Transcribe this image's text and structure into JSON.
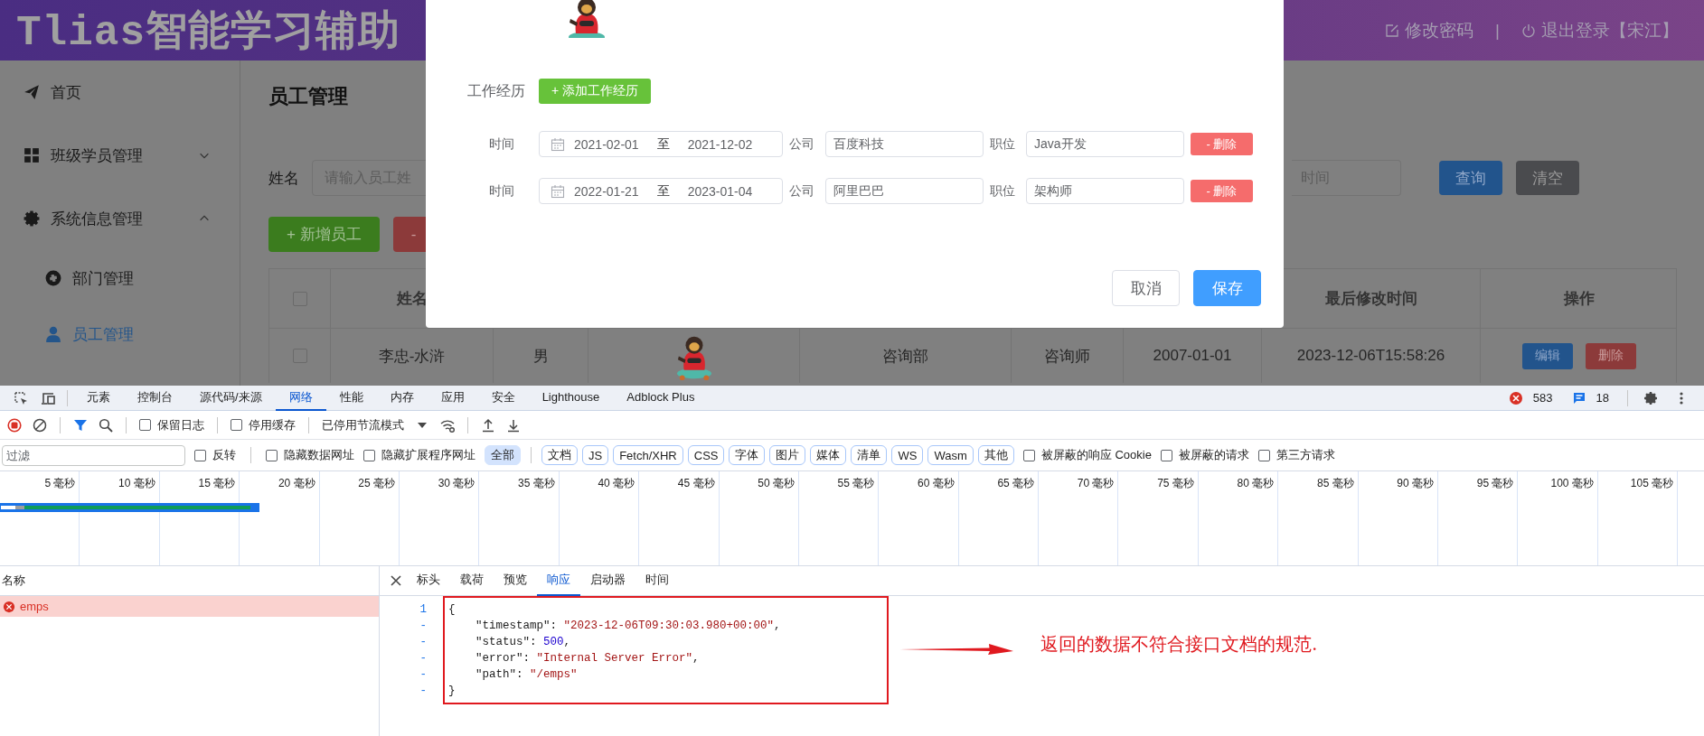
{
  "app": {
    "header": {
      "title": "Tlias智能学习辅助",
      "separator": "|",
      "links": [
        {
          "kind": "edit",
          "label": "修改密码"
        },
        {
          "kind": "power",
          "label": "退出登录【宋江】"
        }
      ]
    },
    "sidebar": {
      "items": [
        {
          "label": "首页",
          "selected": false
        },
        {
          "label": "班级学员管理",
          "selected": false,
          "expanded": false
        },
        {
          "label": "系统信息管理",
          "selected": false,
          "expanded": true,
          "children": [
            {
              "label": "部门管理",
              "selected": false
            },
            {
              "label": "员工管理",
              "selected": true
            }
          ]
        }
      ]
    },
    "page_title": "员工管理",
    "search": {
      "name_label": "姓名",
      "name_placeholder": "请输入员工姓",
      "end_placeholder": "时间",
      "buttons": [
        {
          "kind": "primary",
          "label": "查询"
        },
        {
          "kind": "info",
          "label": "清空"
        }
      ]
    },
    "actions": [
      {
        "kind": "success",
        "label": "+ 新增员工"
      },
      {
        "kind": "danger",
        "label": "-"
      }
    ],
    "table": {
      "header_checked": false,
      "header": {
        "name": "姓名",
        "last_modified": "最后修改时间",
        "operations": "操作"
      },
      "rows": [
        {
          "checked": false,
          "name": "李忠-水浒",
          "gender": "男",
          "avatar": {
            "kind": "picture"
          },
          "dept": "咨询部",
          "job": "咨询师",
          "entry_date": "2007-01-01",
          "last_modified": "2023-12-06T15:58:26",
          "buttons": [
            {
              "kind": "primary",
              "label": "编辑"
            },
            {
              "kind": "danger",
              "label": "删除"
            }
          ]
        }
      ]
    },
    "dialog": {
      "avatar": {
        "kind": "picture"
      },
      "section_label": "工作经历",
      "add_button": "+ 添加工作经历",
      "rows": [
        {
          "time_label": "时间",
          "start": "2021-02-01",
          "range_sep": "至",
          "end": "2021-12-02",
          "company_label": "公司",
          "company": "百度科技",
          "position_label": "职位",
          "position": "Java开发",
          "delete_button": "- 删除"
        },
        {
          "time_label": "时间",
          "start": "2022-01-21",
          "range_sep": "至",
          "end": "2023-01-04",
          "company_label": "公司",
          "company": "阿里巴巴",
          "position_label": "职位",
          "position": "架构师",
          "delete_button": "- 删除"
        }
      ],
      "buttons": [
        {
          "kind": "default",
          "label": "取消"
        },
        {
          "kind": "primary",
          "label": "保存"
        }
      ]
    }
  },
  "devtools": {
    "tabs": [
      {
        "label": "元素",
        "selected": false
      },
      {
        "label": "控制台",
        "selected": false
      },
      {
        "label": "源代码/来源",
        "selected": false
      },
      {
        "label": "网络",
        "selected": true
      },
      {
        "label": "性能",
        "selected": false
      },
      {
        "label": "内存",
        "selected": false
      },
      {
        "label": "应用",
        "selected": false
      },
      {
        "label": "安全",
        "selected": false
      },
      {
        "label": "Lighthouse",
        "selected": false
      },
      {
        "label": "Adblock Plus",
        "selected": false
      }
    ],
    "error_count": "583",
    "message_count": "18",
    "toolbar": {
      "checkboxes": [
        {
          "label": "保留日志",
          "checked": false
        },
        {
          "label": "停用缓存",
          "checked": false
        }
      ],
      "throttling": "已停用节流模式"
    },
    "filter": {
      "placeholder": "过滤",
      "invert": {
        "label": "反转",
        "checked": false
      },
      "options": [
        {
          "label": "隐藏数据网址",
          "checked": false
        },
        {
          "label": "隐藏扩展程序网址",
          "checked": false
        }
      ],
      "types": [
        {
          "label": "全部",
          "selected": true
        },
        {
          "label": "文档",
          "selected": false
        },
        {
          "label": "JS",
          "selected": false
        },
        {
          "label": "Fetch/XHR",
          "selected": false
        },
        {
          "label": "CSS",
          "selected": false
        },
        {
          "label": "字体",
          "selected": false
        },
        {
          "label": "图片",
          "selected": false
        },
        {
          "label": "媒体",
          "selected": false
        },
        {
          "label": "清单",
          "selected": false
        },
        {
          "label": "WS",
          "selected": false
        },
        {
          "label": "Wasm",
          "selected": false
        },
        {
          "label": "其他",
          "selected": false
        }
      ],
      "extra": [
        {
          "label": "被屏蔽的响应 Cookie",
          "checked": false
        },
        {
          "label": "被屏蔽的请求",
          "checked": false
        },
        {
          "label": "第三方请求",
          "checked": false
        }
      ]
    },
    "timeline": {
      "ticks": [
        "5 毫秒",
        "10 毫秒",
        "15 毫秒",
        "20 毫秒",
        "25 毫秒",
        "30 毫秒",
        "35 毫秒",
        "40 毫秒",
        "45 毫秒",
        "50 毫秒",
        "55 毫秒",
        "60 毫秒",
        "65 毫秒",
        "70 毫秒",
        "75 毫秒",
        "80 毫秒",
        "85 毫秒",
        "90 毫秒",
        "95 毫秒",
        "100 毫秒",
        "105 毫秒"
      ]
    },
    "requests": {
      "header": "名称",
      "rows": [
        {
          "name": "emps",
          "error": true
        }
      ]
    },
    "detail": {
      "tabs": [
        {
          "label": "标头",
          "selected": false
        },
        {
          "label": "载荷",
          "selected": false
        },
        {
          "label": "预览",
          "selected": false
        },
        {
          "label": "响应",
          "selected": true
        },
        {
          "label": "启动器",
          "selected": false
        },
        {
          "label": "时间",
          "selected": false
        }
      ],
      "line_numbers": [
        "1",
        "-",
        "-",
        "-",
        "-",
        "-"
      ],
      "lines": [
        {
          "kind": "brace",
          "parts": [
            {
              "kind": "punct",
              "text": "{"
            }
          ]
        },
        {
          "kind": "member",
          "parts": [
            {
              "kind": "key",
              "text": "\"timestamp\": "
            },
            {
              "kind": "string",
              "text": "\"2023-12-06T09:30:03.980+00:00\""
            },
            {
              "kind": "punct",
              "text": ","
            }
          ]
        },
        {
          "kind": "member",
          "parts": [
            {
              "kind": "key",
              "text": "\"status\": "
            },
            {
              "kind": "number",
              "text": "500"
            },
            {
              "kind": "punct",
              "text": ","
            }
          ]
        },
        {
          "kind": "member",
          "parts": [
            {
              "kind": "key",
              "text": "\"error\": "
            },
            {
              "kind": "string",
              "text": "\"Internal Server Error\""
            },
            {
              "kind": "punct",
              "text": ","
            }
          ]
        },
        {
          "kind": "member",
          "parts": [
            {
              "kind": "key",
              "text": "\"path\": "
            },
            {
              "kind": "string",
              "text": "\"/emps\""
            }
          ]
        },
        {
          "kind": "brace",
          "parts": [
            {
              "kind": "punct",
              "text": "}"
            }
          ]
        }
      ]
    },
    "annotation": "返回的数据不符合接口文档的规范."
  }
}
